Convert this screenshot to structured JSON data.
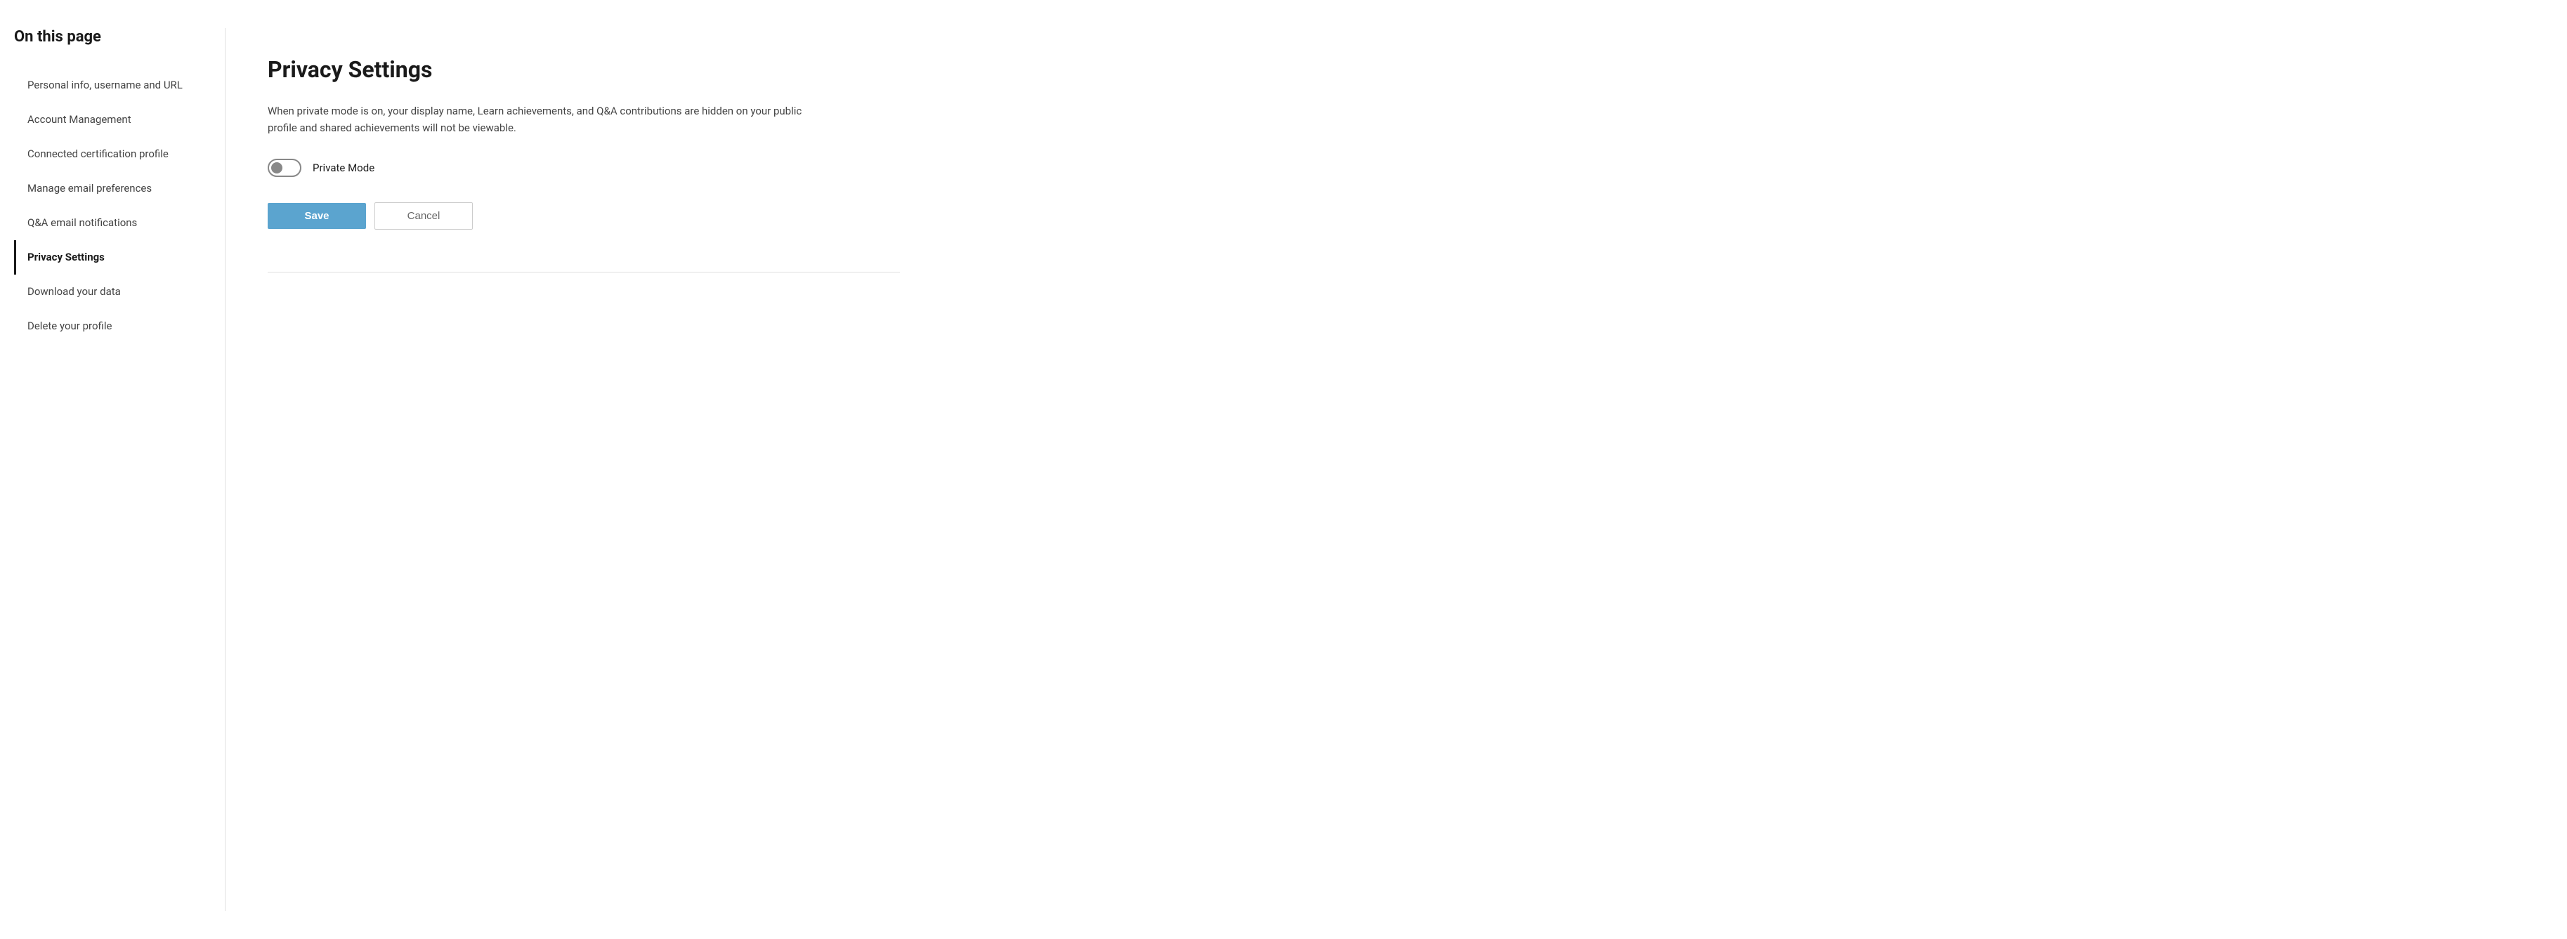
{
  "sidebar": {
    "heading": "On this page",
    "items": [
      {
        "id": "personal-info",
        "label": "Personal info, username and URL",
        "active": false
      },
      {
        "id": "account-management",
        "label": "Account Management",
        "active": false
      },
      {
        "id": "connected-certification",
        "label": "Connected certification profile",
        "active": false
      },
      {
        "id": "manage-email",
        "label": "Manage email preferences",
        "active": false
      },
      {
        "id": "qa-email",
        "label": "Q&A email notifications",
        "active": false
      },
      {
        "id": "privacy-settings",
        "label": "Privacy Settings",
        "active": true
      },
      {
        "id": "download-data",
        "label": "Download your data",
        "active": false
      },
      {
        "id": "delete-profile",
        "label": "Delete your profile",
        "active": false
      }
    ]
  },
  "main": {
    "section_title": "Privacy Settings",
    "section_description": "When private mode is on, your display name, Learn achievements, and Q&A contributions are hidden on your public profile and shared achievements will not be viewable.",
    "toggle_label": "Private Mode",
    "toggle_checked": false,
    "save_label": "Save",
    "cancel_label": "Cancel"
  }
}
